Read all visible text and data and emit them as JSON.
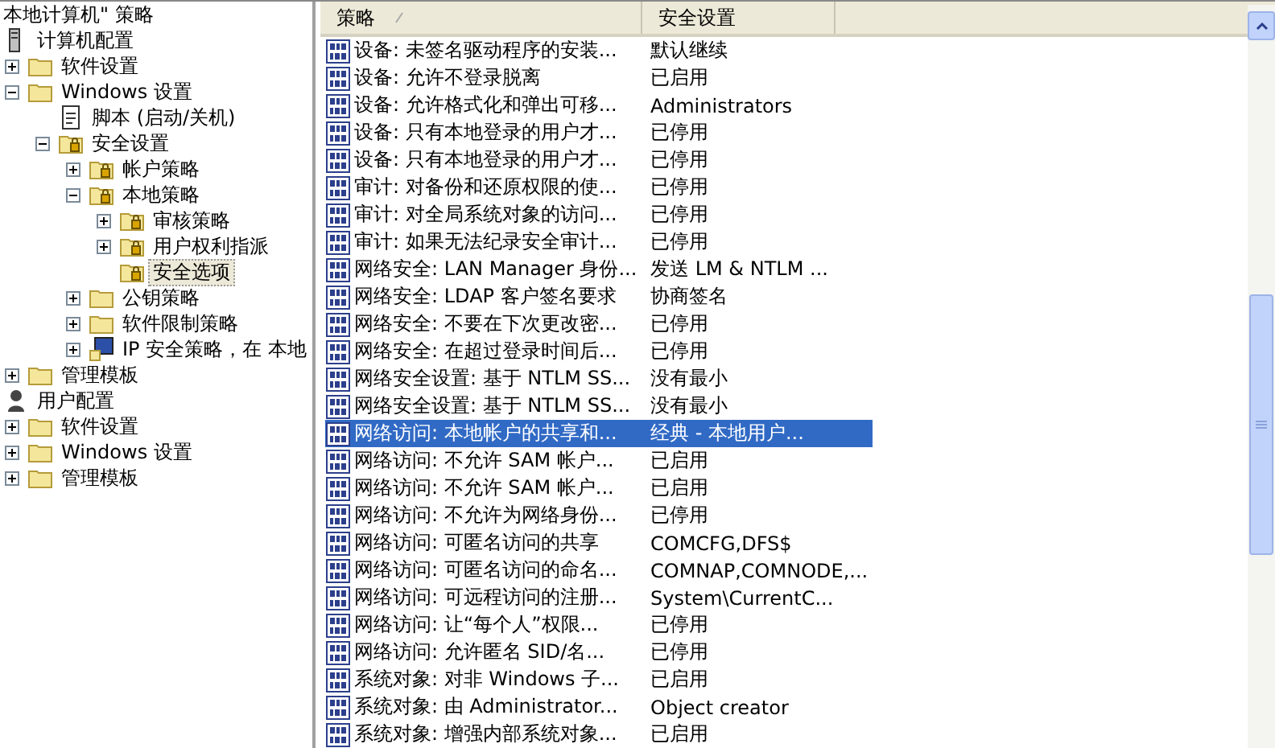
{
  "tree": {
    "title": "本地计算机\" 策略",
    "items": [
      {
        "label": "计算机配置",
        "kind": "computer",
        "selected": false,
        "children": [
          {
            "label": "软件设置",
            "kind": "folder",
            "expanded": false,
            "selected": false
          },
          {
            "label": "Windows 设置",
            "kind": "folder",
            "expanded": true,
            "selected": false,
            "children": [
              {
                "label": "脚本 (启动/关机)",
                "kind": "script",
                "selected": false
              },
              {
                "label": "安全设置",
                "kind": "secure",
                "expanded": true,
                "selected": false,
                "children": [
                  {
                    "label": "帐户策略",
                    "kind": "secure",
                    "expanded": false,
                    "selected": false
                  },
                  {
                    "label": "本地策略",
                    "kind": "secure",
                    "expanded": true,
                    "selected": false,
                    "children": [
                      {
                        "label": "审核策略",
                        "kind": "secure",
                        "expanded": false,
                        "selected": false
                      },
                      {
                        "label": "用户权利指派",
                        "kind": "secure",
                        "expanded": false,
                        "selected": false
                      },
                      {
                        "label": "安全选项",
                        "kind": "secure",
                        "selected": true
                      }
                    ]
                  },
                  {
                    "label": "公钥策略",
                    "kind": "folder",
                    "expanded": false,
                    "selected": false
                  },
                  {
                    "label": "软件限制策略",
                    "kind": "folder",
                    "expanded": false,
                    "selected": false
                  },
                  {
                    "label": "IP 安全策略，在 本地",
                    "kind": "ip",
                    "expanded": false,
                    "selected": false
                  }
                ]
              }
            ]
          },
          {
            "label": "管理模板",
            "kind": "folder",
            "expanded": false,
            "selected": false
          }
        ]
      },
      {
        "label": "用户配置",
        "kind": "user",
        "selected": false,
        "children": [
          {
            "label": "软件设置",
            "kind": "folder",
            "expanded": false,
            "selected": false
          },
          {
            "label": "Windows 设置",
            "kind": "folder",
            "expanded": false,
            "selected": false
          },
          {
            "label": "管理模板",
            "kind": "folder",
            "expanded": false,
            "selected": false
          }
        ]
      }
    ]
  },
  "list": {
    "columns": [
      "策略",
      "安全设置"
    ],
    "rows": [
      {
        "policy": "设备: 未签名驱动程序的安装...",
        "setting": "默认继续",
        "selected": false
      },
      {
        "policy": "设备: 允许不登录脱离",
        "setting": "已启用",
        "selected": false
      },
      {
        "policy": "设备: 允许格式化和弹出可移...",
        "setting": "Administrators",
        "selected": false
      },
      {
        "policy": "设备: 只有本地登录的用户才...",
        "setting": "已停用",
        "selected": false
      },
      {
        "policy": "设备: 只有本地登录的用户才...",
        "setting": "已停用",
        "selected": false
      },
      {
        "policy": "审计: 对备份和还原权限的使...",
        "setting": "已停用",
        "selected": false
      },
      {
        "policy": "审计: 对全局系统对象的访问...",
        "setting": "已停用",
        "selected": false
      },
      {
        "policy": "审计: 如果无法纪录安全审计...",
        "setting": "已停用",
        "selected": false
      },
      {
        "policy": "网络安全: LAN Manager 身份...",
        "setting": "发送 LM & NTLM ...",
        "selected": false
      },
      {
        "policy": "网络安全: LDAP 客户签名要求",
        "setting": "协商签名",
        "selected": false
      },
      {
        "policy": "网络安全: 不要在下次更改密...",
        "setting": "已停用",
        "selected": false
      },
      {
        "policy": "网络安全: 在超过登录时间后...",
        "setting": "已停用",
        "selected": false
      },
      {
        "policy": "网络安全设置: 基于 NTLM SS...",
        "setting": "没有最小",
        "selected": false
      },
      {
        "policy": "网络安全设置: 基于 NTLM SS...",
        "setting": "没有最小",
        "selected": false
      },
      {
        "policy": "网络访问: 本地帐户的共享和...",
        "setting": "经典 - 本地用户...",
        "selected": true
      },
      {
        "policy": "网络访问: 不允许 SAM 帐户...",
        "setting": "已启用",
        "selected": false
      },
      {
        "policy": "网络访问: 不允许 SAM 帐户...",
        "setting": "已启用",
        "selected": false
      },
      {
        "policy": "网络访问: 不允许为网络身份...",
        "setting": "已停用",
        "selected": false
      },
      {
        "policy": "网络访问: 可匿名访问的共享",
        "setting": "COMCFG,DFS$",
        "selected": false
      },
      {
        "policy": "网络访问: 可匿名访问的命名...",
        "setting": "COMNAP,COMNODE,...",
        "selected": false
      },
      {
        "policy": "网络访问: 可远程访问的注册...",
        "setting": "System\\CurrentC...",
        "selected": false
      },
      {
        "policy": "网络访问: 让“每个人”权限...",
        "setting": "已停用",
        "selected": false
      },
      {
        "policy": "网络访问: 允许匿名 SID/名...",
        "setting": "已停用",
        "selected": false
      },
      {
        "policy": "系统对象: 对非 Windows 子...",
        "setting": "已启用",
        "selected": false
      },
      {
        "policy": "系统对象: 由 Administrator...",
        "setting": "Object creator",
        "selected": false
      },
      {
        "policy": "系统对象: 增强内部系统对象...",
        "setting": "已启用",
        "selected": false
      }
    ]
  }
}
